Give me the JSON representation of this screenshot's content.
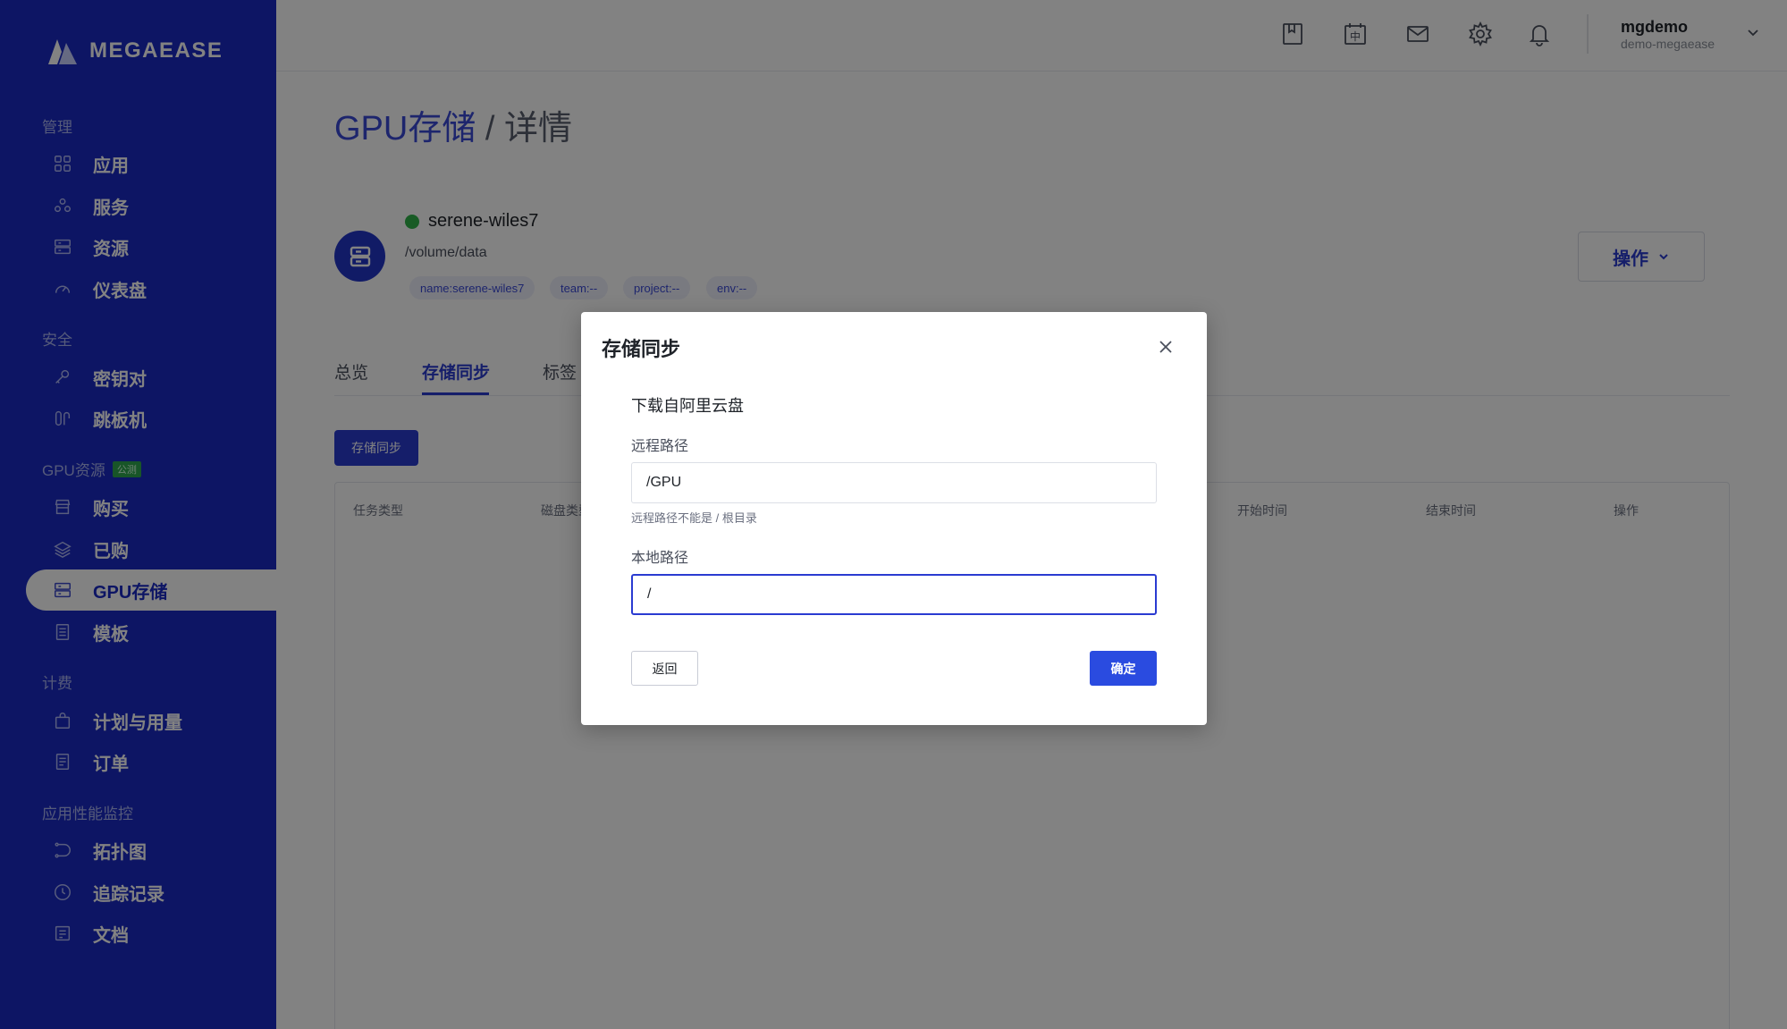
{
  "brand": {
    "name": "MEGAEASE"
  },
  "sidebar": {
    "groups": [
      {
        "label": "管理",
        "items": [
          {
            "label": "应用",
            "icon": "grid-icon"
          },
          {
            "label": "服务",
            "icon": "services-icon"
          },
          {
            "label": "资源",
            "icon": "server-icon"
          },
          {
            "label": "仪表盘",
            "icon": "gauge-icon"
          }
        ]
      },
      {
        "label": "安全",
        "items": [
          {
            "label": "密钥对",
            "icon": "key-icon"
          },
          {
            "label": "跳板机",
            "icon": "jump-icon"
          }
        ]
      },
      {
        "label": "GPU资源",
        "badge": "公测",
        "items": [
          {
            "label": "购买",
            "icon": "store-icon"
          },
          {
            "label": "已购",
            "icon": "layers-icon"
          },
          {
            "label": "GPU存储",
            "icon": "storage-icon",
            "active": true
          },
          {
            "label": "模板",
            "icon": "document-icon"
          }
        ]
      },
      {
        "label": "计费",
        "items": [
          {
            "label": "计划与用量",
            "icon": "bag-icon"
          },
          {
            "label": "订单",
            "icon": "receipt-icon"
          }
        ]
      },
      {
        "label": "应用性能监控",
        "items": [
          {
            "label": "拓扑图",
            "icon": "topology-icon"
          },
          {
            "label": "追踪记录",
            "icon": "clock-icon"
          },
          {
            "label": "文档",
            "icon": "doc-icon"
          }
        ]
      }
    ]
  },
  "topbar": {
    "icons": [
      "bookmark-icon",
      "language-icon",
      "mail-icon",
      "settings-icon",
      "bell-icon"
    ],
    "language_glyph": "中",
    "user": {
      "name": "mgdemo",
      "org": "demo-megaease"
    }
  },
  "page": {
    "title_main": "GPU存储",
    "title_sep": " / ",
    "title_sub": "详情",
    "storage": {
      "name": "serene-wiles7",
      "path": "/volume/data",
      "status_color": "#2fb34a",
      "tags": [
        "name:serene-wiles7",
        "team:--",
        "project:--",
        "env:--"
      ]
    },
    "ops_label": "操作",
    "tabs": [
      {
        "label": "总览"
      },
      {
        "label": "存储同步",
        "active": true
      },
      {
        "label": "标签"
      }
    ],
    "sync_button": "存储同步",
    "table_headers": [
      "任务类型",
      "磁盘类型",
      "开始时间",
      "结束时间",
      "操作"
    ]
  },
  "modal": {
    "title": "存储同步",
    "section": "下载自阿里云盘",
    "remote_label": "远程路径",
    "remote_value": "/GPU",
    "remote_hint": "远程路径不能是 / 根目录",
    "local_label": "本地路径",
    "local_value": "/",
    "back_label": "返回",
    "confirm_label": "确定"
  },
  "colors": {
    "sidebar": "#1a2ac4",
    "accent": "#2a3bd1",
    "confirm": "#2a4be0"
  }
}
